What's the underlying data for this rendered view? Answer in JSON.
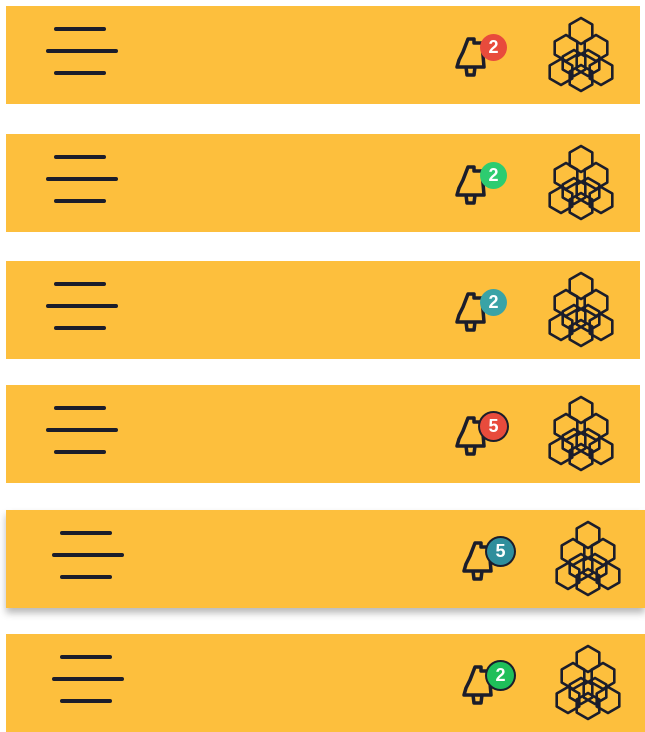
{
  "theme": {
    "bar_color": "#FDBF3D",
    "icon_color": "#1b1d2b"
  },
  "header_variants": [
    {
      "menu_icon": "hamburger-icon",
      "notification_icon": "bell-icon",
      "badge_count": "2",
      "badge_color": "#E84B3C",
      "badge_outlined": false,
      "logo_icon": "hexagon-cluster-logo"
    },
    {
      "menu_icon": "hamburger-icon",
      "notification_icon": "bell-icon",
      "badge_count": "2",
      "badge_color": "#2DCC70",
      "badge_outlined": false,
      "logo_icon": "hexagon-cluster-logo"
    },
    {
      "menu_icon": "hamburger-icon",
      "notification_icon": "bell-icon",
      "badge_count": "2",
      "badge_color": "#3AA3A6",
      "badge_outlined": false,
      "logo_icon": "hexagon-cluster-logo"
    },
    {
      "menu_icon": "hamburger-icon",
      "notification_icon": "bell-icon",
      "badge_count": "5",
      "badge_color": "#E84B3C",
      "badge_outlined": true,
      "logo_icon": "hexagon-cluster-logo"
    },
    {
      "menu_icon": "hamburger-icon",
      "notification_icon": "bell-icon",
      "badge_count": "5",
      "badge_color": "#2F8E9C",
      "badge_outlined": true,
      "logo_icon": "hexagon-cluster-logo"
    },
    {
      "menu_icon": "hamburger-icon",
      "notification_icon": "bell-icon",
      "badge_count": "2",
      "badge_color": "#1FBF5A",
      "badge_outlined": true,
      "logo_icon": "hexagon-cluster-logo"
    }
  ]
}
